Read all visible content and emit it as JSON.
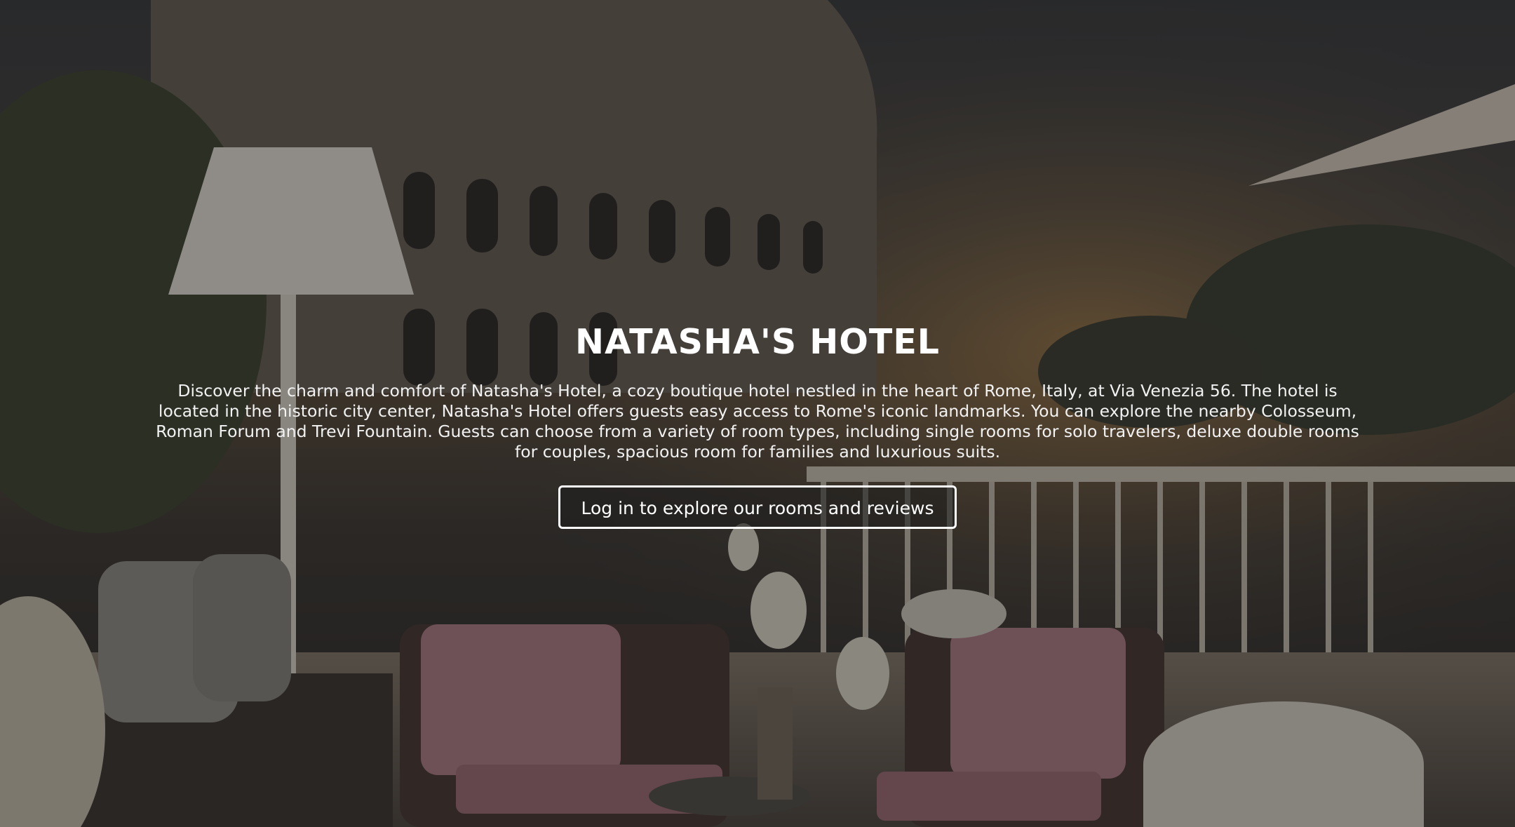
{
  "hero": {
    "title": "NATASHA'S HOTEL",
    "description": "Discover the charm and comfort of Natasha's Hotel, a cozy boutique hotel nestled in the heart of Rome, Italy, at Via Venezia 56. The hotel is located in the historic city center, Natasha's Hotel offers guests easy access to Rome's iconic landmarks. You can explore the nearby Colosseum, Roman Forum and Trevi Fountain. Guests can choose from a variety of room types, including single rooms for solo travelers, deluxe double rooms for couples, spacious room for families and luxurious suits.",
    "cta_label": "Log in to explore our rooms and reviews"
  },
  "colors": {
    "text": "#ffffff",
    "overlay": "#141416",
    "cushion": "#b8838c"
  }
}
